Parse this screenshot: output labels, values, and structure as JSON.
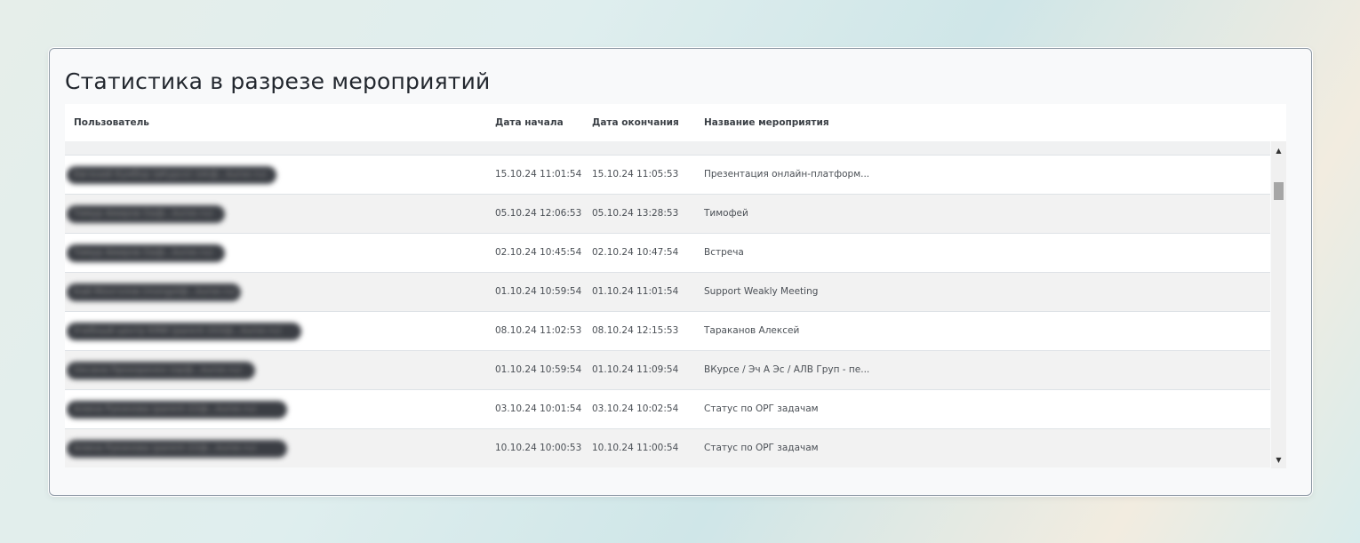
{
  "card": {
    "title": "Статистика в разрезе мероприятий"
  },
  "table": {
    "columns": [
      "Пользователь",
      "Дата начала",
      "Дата окончания",
      "Название мероприятия"
    ],
    "rows": [
      {
        "user": "Евгений Кумбор (вКурсе) (ek@...kurse.ru)",
        "start": "15.10.24 11:01:54",
        "end": "15.10.24 11:05:53",
        "title": "Презентация онлайн-платформ..."
      },
      {
        "user": "Тимур Амиров (ta@...kurse.ru)",
        "start": "05.10.24 12:06:53",
        "end": "05.10.24 13:28:53",
        "title": "Тимофей"
      },
      {
        "user": "Тимур Амиров (ta@...kurse.ru)",
        "start": "02.10.24 10:45:54",
        "end": "02.10.24 10:47:54",
        "title": "Встреча"
      },
      {
        "user": "Кай Монголов (mongol@...kurse.ru)",
        "start": "01.10.24 10:59:54",
        "end": "01.10.24 11:01:54",
        "title": "Support Weakly Meeting"
      },
      {
        "user": "Учебный центр КМИ (parent-203@...kurse.ru)",
        "start": "08.10.24 11:02:53",
        "end": "08.10.24 12:15:53",
        "title": "Тараканов Алексей"
      },
      {
        "user": "Оксана Прохоренко (op@...kurse.ru)",
        "start": "01.10.24 10:59:54",
        "end": "01.10.24 11:09:54",
        "title": "ВКурсе / Эч А Эс / АЛВ Груп - пе..."
      },
      {
        "user": "Алина Рукинова (parent-22@...kurse.ru)",
        "start": "03.10.24 10:01:54",
        "end": "03.10.24 10:02:54",
        "title": "Статус по ОРГ задачам"
      },
      {
        "user": "Алина Рукинова (parent-22@...kurse.ru)",
        "start": "10.10.24 10:00:53",
        "end": "10.10.24 11:00:54",
        "title": "Статус по ОРГ задачам"
      }
    ]
  },
  "icons": {
    "scroll_up": "▲",
    "scroll_down": "▼"
  }
}
